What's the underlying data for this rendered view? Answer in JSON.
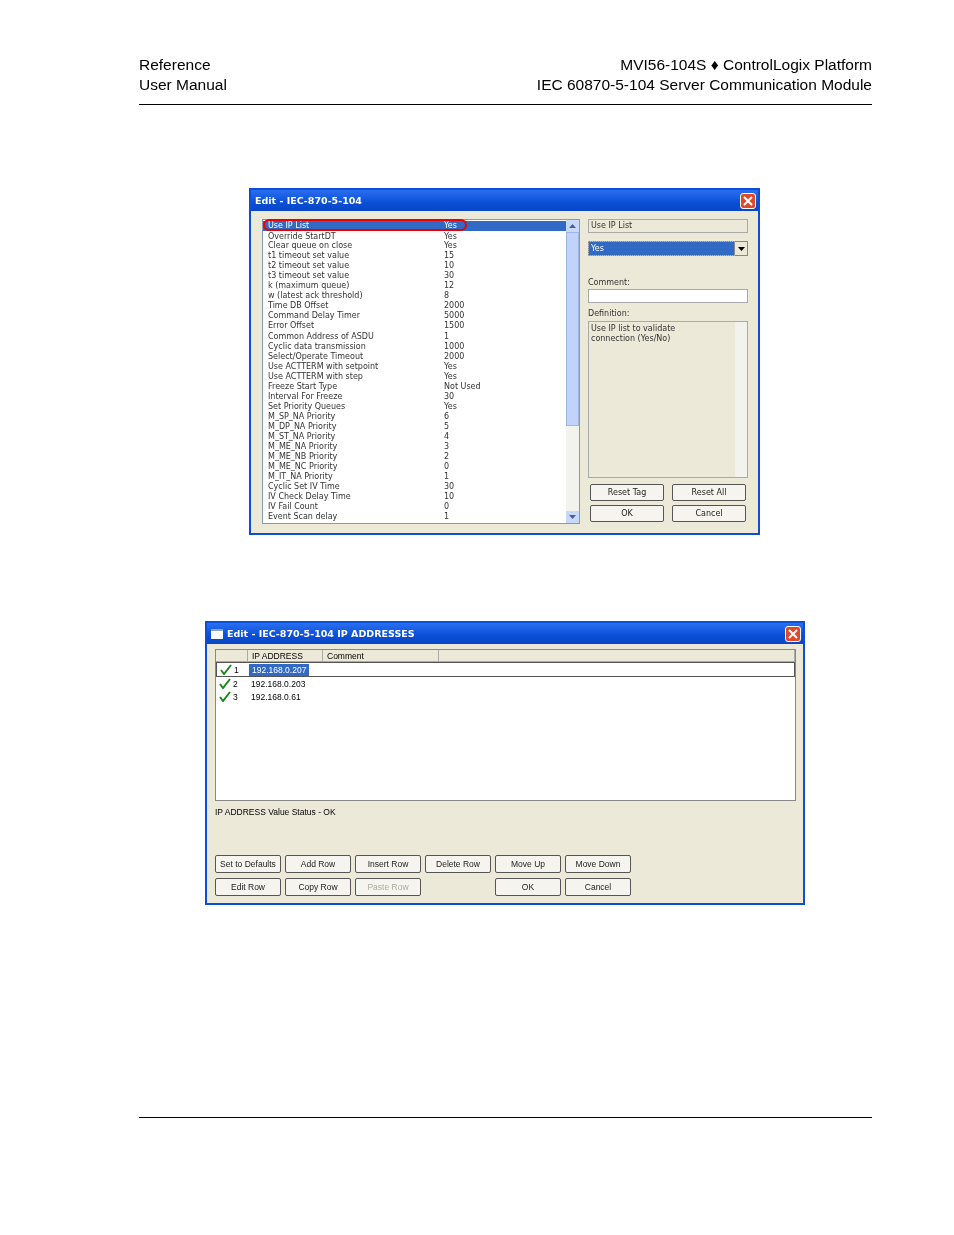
{
  "header": {
    "left_lines": [
      "Reference",
      "User Manual"
    ],
    "right_lines": [
      "MVI56-104S ♦ ControlLogix Platform",
      "IEC 60870-5-104 Server Communication Module"
    ]
  },
  "edit_dialog": {
    "title": "Edit - IEC-870-5-104",
    "parameters": [
      {
        "name": "Use IP List",
        "value": "Yes",
        "selected": true,
        "highlighted": true
      },
      {
        "name": "Override StartDT",
        "value": "Yes",
        "selected": false,
        "highlighted": false
      },
      {
        "name": "Clear queue on close",
        "value": "Yes",
        "selected": false,
        "highlighted": false
      },
      {
        "name": "t1 timeout set value",
        "value": "15",
        "selected": false,
        "highlighted": false
      },
      {
        "name": "t2 timeout set value",
        "value": "10",
        "selected": false,
        "highlighted": false
      },
      {
        "name": "t3 timeout set value",
        "value": "30",
        "selected": false,
        "highlighted": false
      },
      {
        "name": "k (maximum queue)",
        "value": "12",
        "selected": false,
        "highlighted": false
      },
      {
        "name": "w (latest ack threshold)",
        "value": "8",
        "selected": false,
        "highlighted": false
      },
      {
        "name": "Time DB Offset",
        "value": "2000",
        "selected": false,
        "highlighted": false
      },
      {
        "name": "Command Delay Timer",
        "value": "5000",
        "selected": false,
        "highlighted": false
      },
      {
        "name": "Error Offset",
        "value": "1500",
        "selected": false,
        "highlighted": false
      },
      {
        "name": "Common Address of ASDU",
        "value": "1",
        "selected": false,
        "highlighted": false
      },
      {
        "name": "Cyclic data transmission",
        "value": "1000",
        "selected": false,
        "highlighted": false
      },
      {
        "name": "Select/Operate Timeout",
        "value": "2000",
        "selected": false,
        "highlighted": false
      },
      {
        "name": "Use ACTTERM with setpoint",
        "value": "Yes",
        "selected": false,
        "highlighted": false
      },
      {
        "name": "Use ACTTERM with step",
        "value": "Yes",
        "selected": false,
        "highlighted": false
      },
      {
        "name": "Freeze Start Type",
        "value": "Not Used",
        "selected": false,
        "highlighted": false
      },
      {
        "name": "Interval For Freeze",
        "value": "30",
        "selected": false,
        "highlighted": false
      },
      {
        "name": "Set Priority Queues",
        "value": "Yes",
        "selected": false,
        "highlighted": false
      },
      {
        "name": "M_SP_NA Priority",
        "value": "6",
        "selected": false,
        "highlighted": false
      },
      {
        "name": "M_DP_NA Priority",
        "value": "5",
        "selected": false,
        "highlighted": false
      },
      {
        "name": "M_ST_NA Priority",
        "value": "4",
        "selected": false,
        "highlighted": false
      },
      {
        "name": "M_ME_NA Priority",
        "value": "3",
        "selected": false,
        "highlighted": false
      },
      {
        "name": "M_ME_NB Priority",
        "value": "2",
        "selected": false,
        "highlighted": false
      },
      {
        "name": "M_ME_NC Priority",
        "value": "0",
        "selected": false,
        "highlighted": false
      },
      {
        "name": "M_IT_NA Priority",
        "value": "1",
        "selected": false,
        "highlighted": false
      },
      {
        "name": "Cyclic Set IV Time",
        "value": "30",
        "selected": false,
        "highlighted": false
      },
      {
        "name": "IV Check Delay Time",
        "value": "10",
        "selected": false,
        "highlighted": false
      },
      {
        "name": "IV Fail Count",
        "value": "0",
        "selected": false,
        "highlighted": false
      },
      {
        "name": "Event Scan delay",
        "value": "1",
        "selected": false,
        "highlighted": false
      }
    ],
    "tag_name": "Use IP List",
    "value_select": "Yes",
    "comment_label": "Comment:",
    "definition_label": "Definition:",
    "definition": "Use IP list to validate connection (Yes/No)",
    "buttons": [
      {
        "label": "Reset Tag"
      },
      {
        "label": "Reset All"
      },
      {
        "label": "OK"
      },
      {
        "label": "Cancel"
      }
    ]
  },
  "ip_dialog": {
    "title": "Edit - IEC-870-5-104 IP ADDRESSES",
    "columns": [
      "IP ADDRESS",
      "Comment"
    ],
    "rows": [
      {
        "number": "1",
        "ip_address": "192.168.0.207",
        "selected": true
      },
      {
        "number": "2",
        "ip_address": "192.168.0.203",
        "selected": false
      },
      {
        "number": "3",
        "ip_address": "192.168.0.61",
        "selected": false
      }
    ],
    "status": "IP ADDRESS Value Status - OK",
    "buttons_row_1": [
      {
        "label": "Set to Defaults",
        "disabled": false
      },
      {
        "label": "Add Row",
        "disabled": false
      },
      {
        "label": "Insert Row",
        "disabled": false
      },
      {
        "label": "Delete Row",
        "disabled": false
      },
      {
        "label": "Move Up",
        "disabled": false
      },
      {
        "label": "Move Down",
        "disabled": false
      }
    ],
    "buttons_row_2": [
      {
        "label": "Edit Row",
        "disabled": false
      },
      {
        "label": "Copy Row",
        "disabled": false
      },
      {
        "label": "Paste Row",
        "disabled": true
      },
      {
        "label": "OK",
        "disabled": false
      },
      {
        "label": "Cancel",
        "disabled": false
      }
    ]
  }
}
